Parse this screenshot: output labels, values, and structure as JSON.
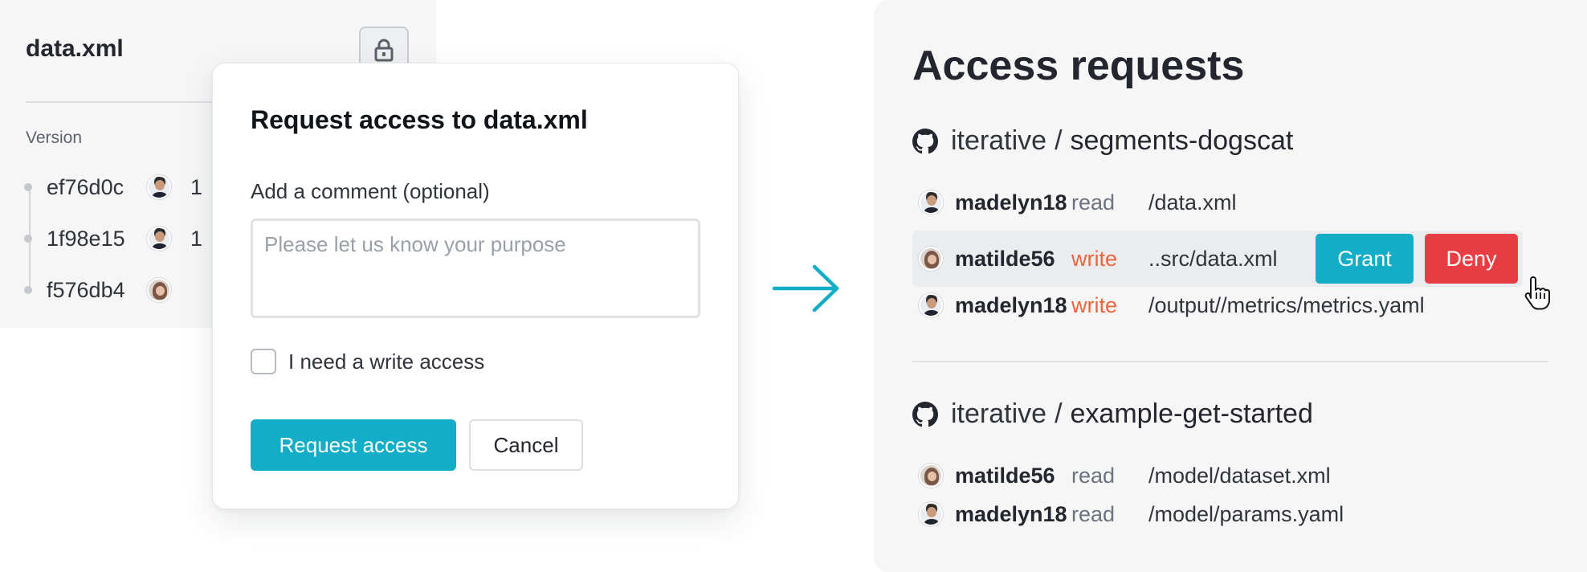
{
  "file_card": {
    "title": "data.xml",
    "version_label": "Version",
    "versions": [
      {
        "hash": "ef76d0c",
        "extra": "1",
        "avatar": "male-avatar"
      },
      {
        "hash": "1f98e15",
        "extra": "1",
        "avatar": "male-avatar"
      },
      {
        "hash": "f576db4",
        "extra": "",
        "avatar": "female-avatar"
      }
    ]
  },
  "dialog": {
    "title": "Request access to data.xml",
    "comment_label": "Add a comment (optional)",
    "comment_value": "",
    "comment_placeholder": "Please let us know your purpose",
    "write_checkbox_label": "I need a write access",
    "write_checked": false,
    "request_button": "Request access",
    "cancel_button": "Cancel"
  },
  "panel": {
    "title": "Access requests",
    "repos": [
      {
        "org": "iterative",
        "separator": "/",
        "name": "segments-dogscat",
        "requests": [
          {
            "user": "madelyn18",
            "permission": "read",
            "path": "/data.xml"
          },
          {
            "user": "matilde56",
            "permission": "write",
            "path": "..src/data.xml",
            "grant": "Grant",
            "deny": "Deny"
          },
          {
            "user": "madelyn18",
            "permission": "write",
            "path": "/output//metrics/metrics.yaml"
          }
        ]
      },
      {
        "org": "iterative",
        "separator": "/",
        "name": "example-get-started",
        "requests": [
          {
            "user": "matilde56",
            "permission": "read",
            "path": "/model/dataset.xml"
          },
          {
            "user": "madelyn18",
            "permission": "read",
            "path": "/model/params.yaml"
          }
        ]
      }
    ]
  },
  "colors": {
    "accent": "#13adc7",
    "danger": "#e83d43",
    "write": "#e8663d",
    "read": "#6b7280",
    "panel_bg": "#f6f6f7"
  },
  "icons": {
    "lock": "lock-icon",
    "arrow": "arrow-right-icon",
    "repo": "github-icon",
    "cursor": "hand-pointer-icon"
  }
}
